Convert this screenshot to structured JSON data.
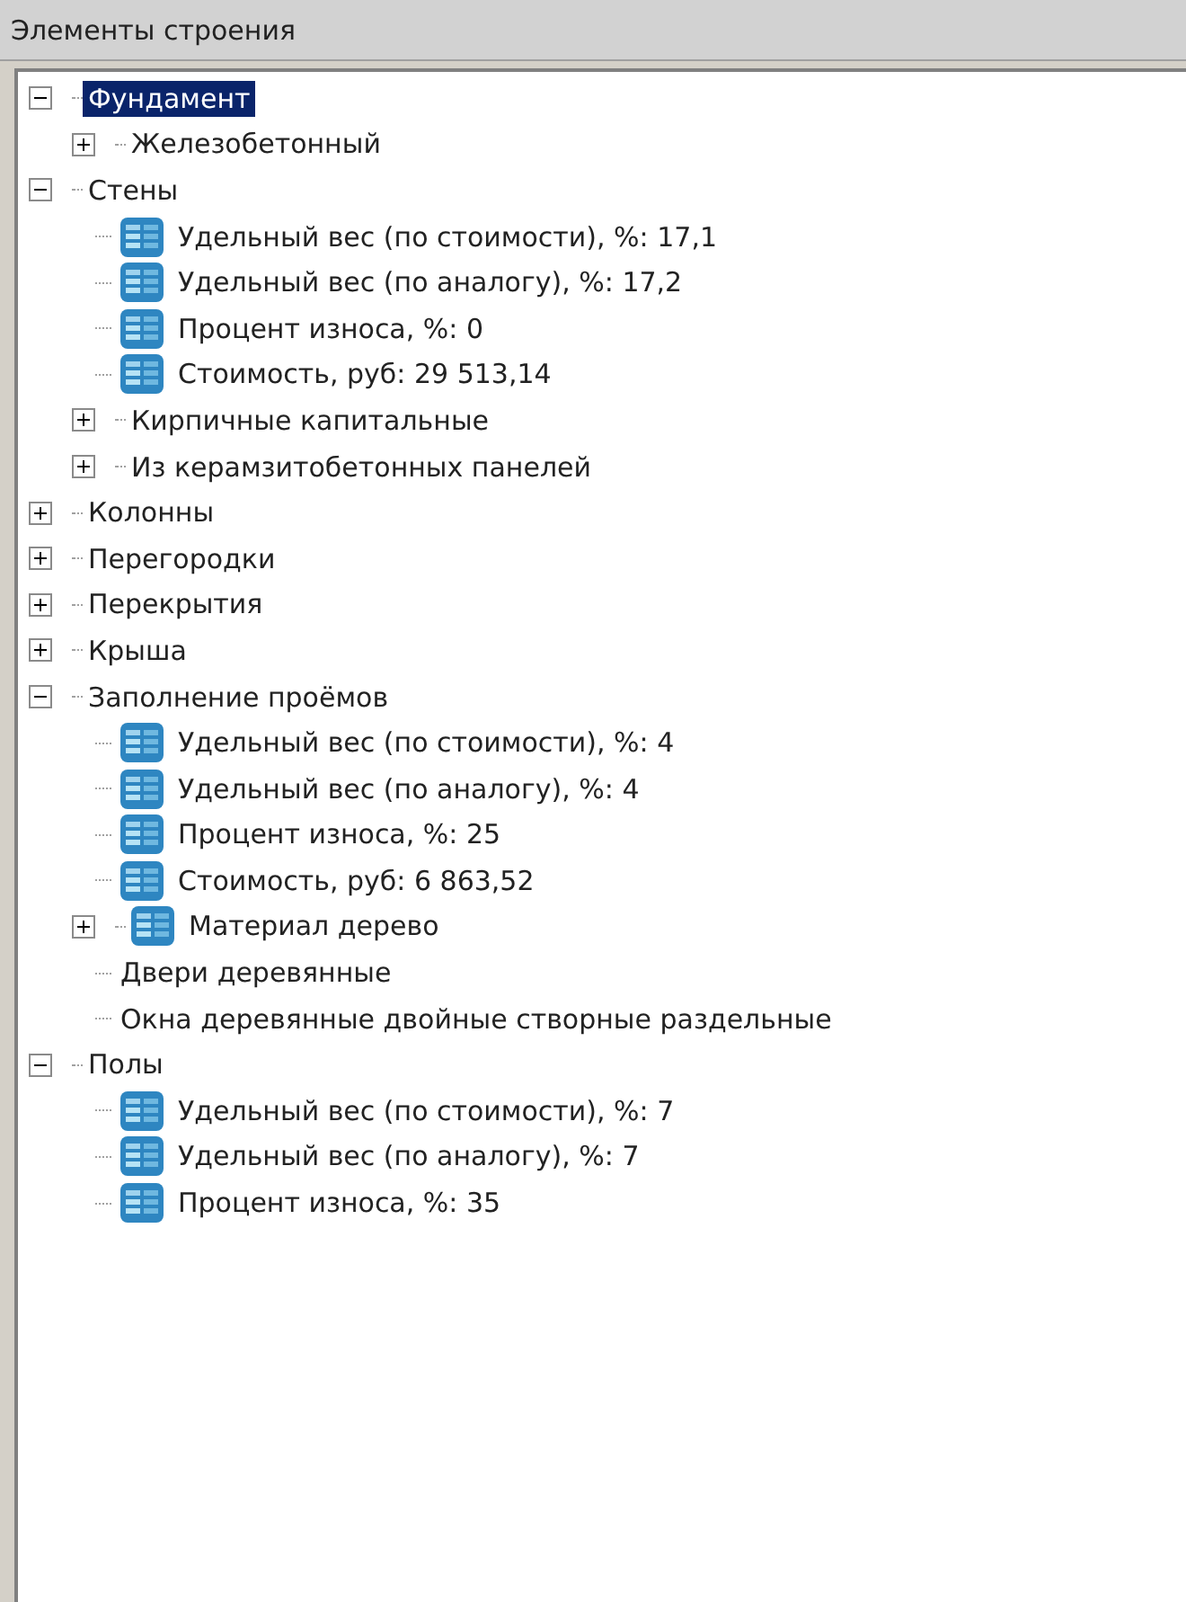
{
  "panel": {
    "title": "Элементы строения"
  },
  "tree": [
    {
      "label": "Фундамент",
      "kind": "folder",
      "expanded": true,
      "selected": true,
      "children": [
        {
          "label": "Железобетонный",
          "kind": "folder",
          "expanded": false,
          "selected": false
        }
      ]
    },
    {
      "label": "Стены",
      "kind": "folder",
      "expanded": true,
      "selected": false,
      "children": [
        {
          "label": "Удельный вес (по стоимости), %: 17,1",
          "kind": "property",
          "selected": false
        },
        {
          "label": "Удельный вес (по аналогу), %: 17,2",
          "kind": "property",
          "selected": false
        },
        {
          "label": "Процент износа, %: 0",
          "kind": "property",
          "selected": false
        },
        {
          "label": "Стоимость, руб: 29 513,14",
          "kind": "property",
          "selected": false
        },
        {
          "label": "Кирпичные капитальные",
          "kind": "folder",
          "expanded": false,
          "selected": false
        },
        {
          "label": "Из керамзитобетонных панелей",
          "kind": "folder",
          "expanded": false,
          "selected": false
        }
      ]
    },
    {
      "label": "Колонны",
      "kind": "folder",
      "expanded": false,
      "selected": false
    },
    {
      "label": "Перегородки",
      "kind": "folder",
      "expanded": false,
      "selected": false
    },
    {
      "label": "Перекрытия",
      "kind": "folder",
      "expanded": false,
      "selected": false
    },
    {
      "label": "Крыша",
      "kind": "folder",
      "expanded": false,
      "selected": false
    },
    {
      "label": "Заполнение проёмов",
      "kind": "folder",
      "expanded": true,
      "selected": false,
      "children": [
        {
          "label": "Удельный вес (по стоимости), %: 4",
          "kind": "property",
          "selected": false
        },
        {
          "label": "Удельный вес (по аналогу), %: 4",
          "kind": "property",
          "selected": false
        },
        {
          "label": "Процент износа, %: 25",
          "kind": "property",
          "selected": false
        },
        {
          "label": "Стоимость, руб: 6 863,52",
          "kind": "property",
          "selected": false
        },
        {
          "label": "Материал дерево",
          "kind": "property",
          "expanded": false,
          "selected": false
        },
        {
          "label": "Двери деревянные",
          "kind": "leaf",
          "selected": false
        },
        {
          "label": "Окна деревянные двойные створные раздельные",
          "kind": "leaf",
          "selected": false
        }
      ]
    },
    {
      "label": "Полы",
      "kind": "folder",
      "expanded": true,
      "selected": false,
      "children": [
        {
          "label": "Удельный вес (по стоимости), %: 7",
          "kind": "property",
          "selected": false
        },
        {
          "label": "Удельный вес (по аналогу), %: 7",
          "kind": "property",
          "selected": false
        },
        {
          "label": "Процент износа, %: 35",
          "kind": "property",
          "selected": false
        }
      ]
    }
  ]
}
